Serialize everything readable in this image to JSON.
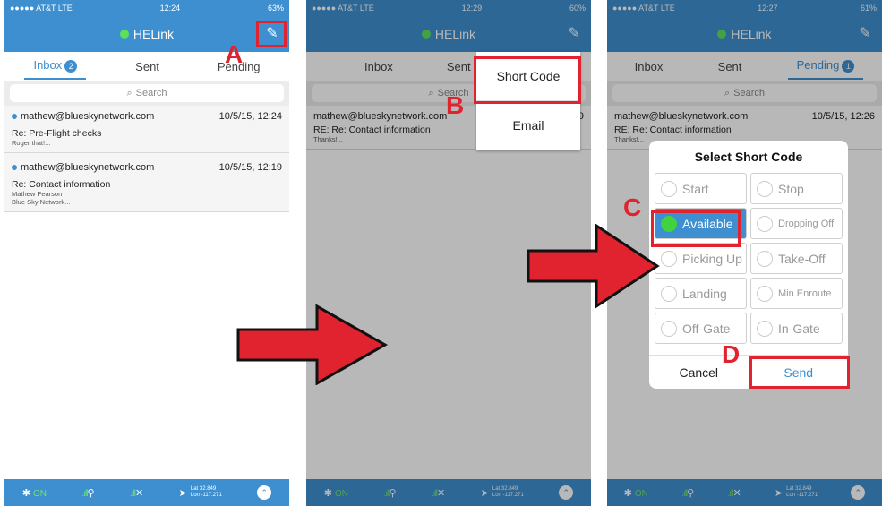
{
  "status": {
    "p1": {
      "carrier": "●●●●● AT&T LTE",
      "time": "12:24",
      "battery": "63%"
    },
    "p2": {
      "carrier": "●●●●● AT&T LTE",
      "time": "12:29",
      "battery": "60%"
    },
    "p3": {
      "carrier": "●●●●● AT&T LTE",
      "time": "12:27",
      "battery": "61%"
    }
  },
  "app_title": "HELink",
  "tabs": {
    "inbox": "Inbox",
    "sent": "Sent",
    "pending": "Pending",
    "inbox_count": "2",
    "pending_count": "1"
  },
  "search_placeholder": "Search",
  "messages": [
    {
      "from": "mathew@blueskynetwork.com",
      "date": "10/5/15, 12:24",
      "subject": "Re: Pre-Flight checks",
      "preview1": "Roger that!...",
      "preview2": ""
    },
    {
      "from": "mathew@blueskynetwork.com",
      "date": "10/5/15, 12:19",
      "subject": "Re: Contact information",
      "preview1": "Mathew Pearson",
      "preview2": "Blue Sky Network..."
    }
  ],
  "msg_p2": {
    "from": "mathew@blueskynetwork.com",
    "date_partial": "9",
    "subject": "RE: Re: Contact information",
    "preview": "Thanks!..."
  },
  "msg_p3": {
    "from": "mathew@blueskynetwork.com",
    "date": "10/5/15, 12:26",
    "subject": "RE: Re: Contact information",
    "preview": "Thanks!..."
  },
  "menu": {
    "short_code": "Short Code",
    "email": "Email"
  },
  "dialog": {
    "title": "Select Short Code",
    "options": [
      "Start",
      "Stop",
      "Available",
      "Dropping Off",
      "Picking Up",
      "Take-Off",
      "Landing",
      "Min Enroute",
      "Off-Gate",
      "In-Gate"
    ],
    "cancel": "Cancel",
    "send": "Send"
  },
  "bottombar": {
    "bt_on": "ON",
    "lat": "Lat 32.849",
    "lon": "Lon -117.271"
  },
  "labels": {
    "a": "A",
    "b": "B",
    "c": "C",
    "d": "D"
  },
  "colors": {
    "primary": "#3d8fd0",
    "highlight": "#e0232e",
    "online": "#5ce05c"
  }
}
